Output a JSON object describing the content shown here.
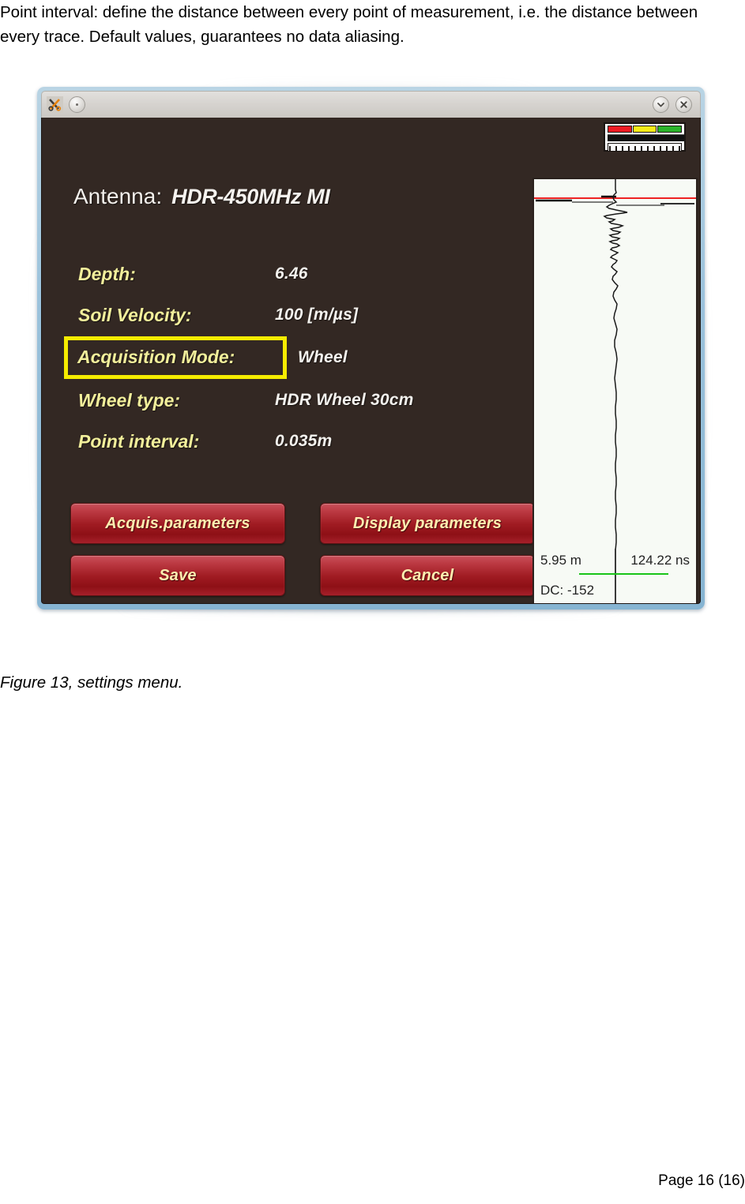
{
  "document": {
    "paragraph": "Point interval: define the distance between every point of measurement, i.e. the distance between every trace. Default values, guarantees no data aliasing.",
    "figure_caption": "Figure 13, settings menu.",
    "page_footer": "Page 16 (16)"
  },
  "window": {
    "titlebar": {
      "app_icon": "scissors-app-icon",
      "menu_button": "window-menu-button",
      "minimize_label": "minimize",
      "close_label": "close"
    },
    "status_indicator": {
      "name": "signal-strength-indicator",
      "segments": [
        "#ee1c24",
        "#f6eb18",
        "#2bb32b"
      ]
    },
    "antenna": {
      "label": "Antenna:",
      "value": "HDR-450MHz MI"
    },
    "parameters": [
      {
        "label": "Depth:",
        "value": "6.46",
        "highlighted": false,
        "name": "depth"
      },
      {
        "label": "Soil Velocity:",
        "value": "100 [m/µs]",
        "highlighted": false,
        "name": "soil-velocity"
      },
      {
        "label": "Acquisition Mode:",
        "value": "Wheel",
        "highlighted": true,
        "name": "acquisition-mode"
      },
      {
        "label": "Wheel type:",
        "value": "HDR Wheel 30cm",
        "highlighted": false,
        "name": "wheel-type"
      },
      {
        "label": "Point interval:",
        "value": "0.035m",
        "highlighted": false,
        "name": "point-interval"
      }
    ],
    "buttons": [
      {
        "label": "Acquis.parameters",
        "name": "acquis-parameters-button"
      },
      {
        "label": "Display parameters",
        "name": "display-parameters-button"
      },
      {
        "label": "Save",
        "name": "save-button"
      },
      {
        "label": "Cancel",
        "name": "cancel-button"
      }
    ],
    "scope": {
      "distance": "5.95 m",
      "time": "124.22 ns",
      "dc": "DC: -152",
      "marker_color": "#ee2222",
      "cursor_color": "#19c419"
    }
  },
  "colors": {
    "window_frame": "#9cc3dc",
    "window_bg": "#332823",
    "label_yellow": "#f2ef9b",
    "highlight_yellow": "#f5ec00",
    "button_red": "#a01b22",
    "button_text": "#ffeeb0"
  }
}
